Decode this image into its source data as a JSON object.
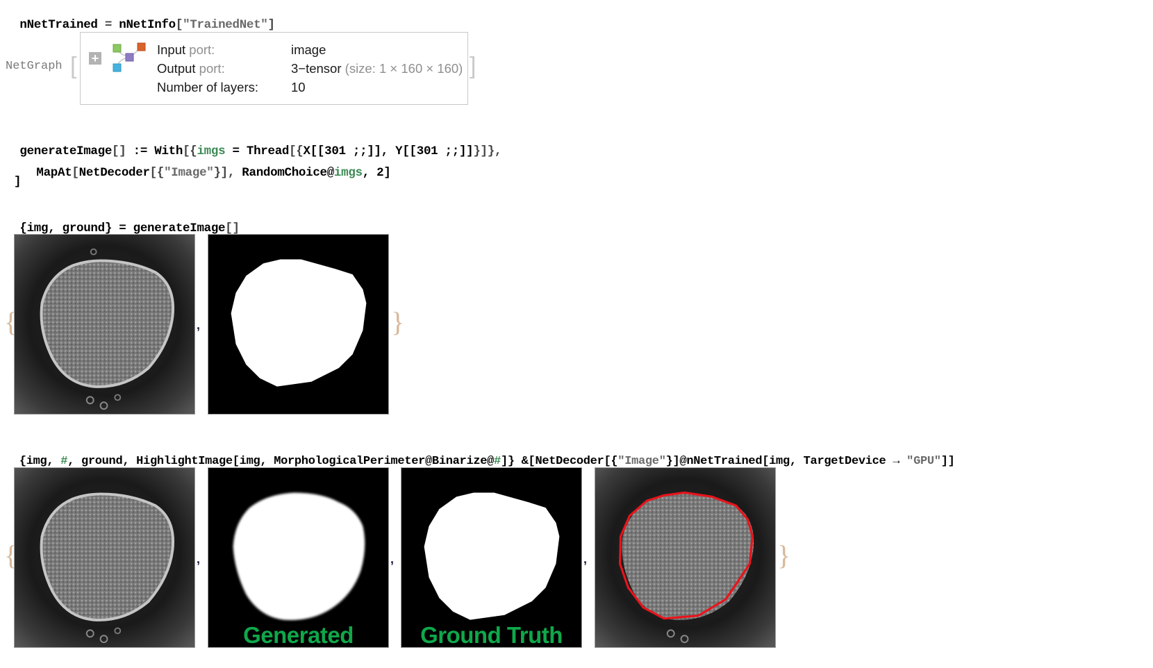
{
  "cells": {
    "cell1": {
      "lhs": "nNetTrained",
      "op": " = ",
      "fn": "nNetInfo",
      "open": "[",
      "arg": "\"TrainedNet\"",
      "close": "]"
    },
    "netgraph": {
      "head": "NetGraph",
      "rows": [
        {
          "key": "Input",
          "key_suffix": " port:",
          "value": "image",
          "value_note": ""
        },
        {
          "key": "Output",
          "key_suffix": " port:",
          "value": "3−tensor",
          "value_note": " (size: 1 × 160 × 160)"
        },
        {
          "key": "",
          "key_suffix": "Number of layers:",
          "value": "10",
          "value_note": ""
        }
      ],
      "expand_symbol": "+",
      "node_colors": [
        "#8dc862",
        "#d9632a",
        "#8e7cc3",
        "#47b2df"
      ]
    },
    "cell2": {
      "line1": {
        "a": "generateImage",
        "b": "[]",
        "c": " := ",
        "d": "With",
        "e": "[{",
        "f": "imgs",
        "g": " = ",
        "h": "Thread",
        "i": "[{",
        "j": "X[[301 ;;]], Y[[301 ;;]]",
        "k": "}]},"
      },
      "line2": {
        "a": "MapAt",
        "b": "[",
        "c": "NetDecoder",
        "d": "[{",
        "e": "\"Image\"",
        "f": "}], ",
        "g": "RandomChoice@",
        "h": "imgs",
        "i": ", 2]"
      },
      "line3": "]"
    },
    "cell3": {
      "a": "{img, ground}",
      "b": " = ",
      "c": "generateImage",
      "d": "[]"
    },
    "output1": {
      "open": "{",
      "close": "}",
      "sep": ","
    },
    "cell4": {
      "a": "{img, ",
      "b": "#",
      "c": ", ground, HighlightImage[img, MorphologicalPerimeter@Binarize@",
      "d": "#",
      "e": "]} &[NetDecoder[{",
      "f": "\"Image\"",
      "g": "}]@nNetTrained[img, TargetDevice → ",
      "h": "\"GPU\"",
      "i": "]]"
    },
    "output2": {
      "open": "{",
      "close": "}",
      "sep": ",",
      "labels": {
        "generated": "Generated",
        "ground_truth": "Ground Truth"
      },
      "label_color": "#0fa84a",
      "highlight_color": "#e8141b"
    }
  }
}
